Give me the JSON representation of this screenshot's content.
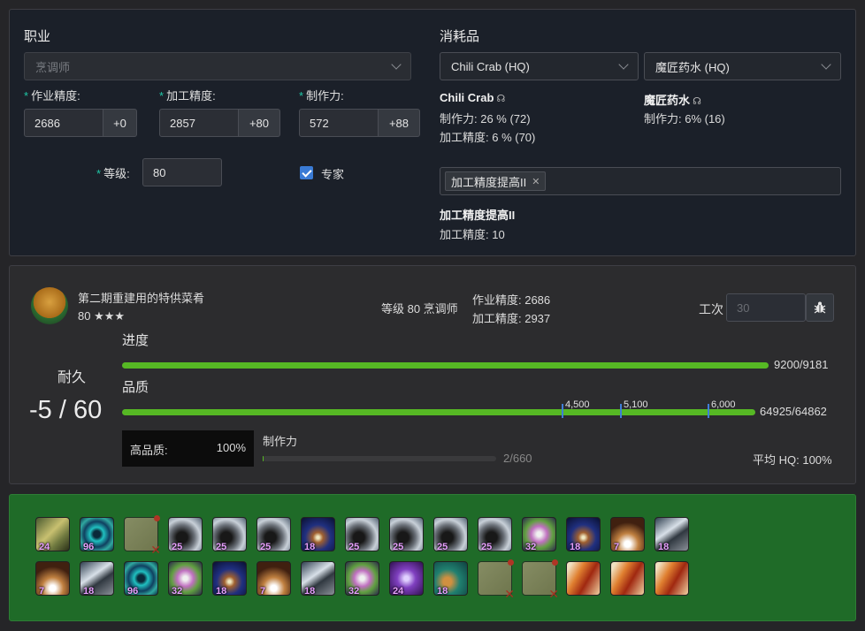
{
  "job": {
    "title": "职业",
    "class_placeholder": "烹调师",
    "craftsmanship_label": "作业精度:",
    "craftsmanship": "2686",
    "craftsmanship_bonus": "+0",
    "control_label": "加工精度:",
    "control": "2857",
    "control_bonus": "+80",
    "cp_label": "制作力:",
    "cp": "572",
    "cp_bonus": "+88",
    "level_label": "等级:",
    "level": "80",
    "specialist_label": "专家"
  },
  "consumables": {
    "title": "消耗品",
    "food_select": "Chili Crab (HQ)",
    "potion_select": "魔匠药水 (HQ)",
    "food": {
      "name": "Chili Crab",
      "line1": "制作力: 26 % (72)",
      "line2": "加工精度: 6 % (70)"
    },
    "potion": {
      "name": "魔匠药水",
      "line1": "制作力: 6% (16)"
    },
    "buff_tag": "加工精度提高II",
    "buff_name": "加工精度提高II",
    "buff_line": "加工精度: 10"
  },
  "sim": {
    "recipe_name": "第二期重建用的特供菜肴",
    "recipe_level": "80 ★★★",
    "crafter_level": "等级 80 烹调师",
    "crafter_craftsmanship": "作业精度: 2686",
    "crafter_control": "加工精度: 2937",
    "steps_label": "工次",
    "steps_placeholder": "30",
    "durability_label": "耐久",
    "durability_value": "-5 / 60",
    "progress_label": "进度",
    "progress_text": "9200/9181",
    "progress_fraction": 1.0,
    "quality_label": "品质",
    "quality_text": "64925/64862",
    "quality_fraction": 1.0,
    "quality_ticks": [
      {
        "label": "4,500"
      },
      {
        "label": "5,100"
      },
      {
        "label": "6,000"
      }
    ],
    "hq_label": "高品质:",
    "hq_value": "100%",
    "cp_label": "制作力",
    "cp_text": "2/660",
    "cp_fraction": 0.003,
    "avg_hq": "平均 HQ: 100%"
  },
  "rotation": {
    "row1": [
      {
        "icon": "muscle-memory-icon",
        "num": "24"
      },
      {
        "icon": "manipulation-icon",
        "num": "96"
      },
      {
        "icon": "failed-action-icon",
        "num": "",
        "failed": true
      },
      {
        "icon": "groundwork-icon",
        "num": "25"
      },
      {
        "icon": "groundwork-icon",
        "num": "25"
      },
      {
        "icon": "groundwork-icon",
        "num": "25"
      },
      {
        "icon": "innovation-icon",
        "num": "18"
      },
      {
        "icon": "groundwork-icon",
        "num": "25"
      },
      {
        "icon": "groundwork-icon",
        "num": "25"
      },
      {
        "icon": "groundwork-icon",
        "num": "25"
      },
      {
        "icon": "groundwork-icon",
        "num": "25"
      },
      {
        "icon": "great-strides-icon",
        "num": "32"
      },
      {
        "icon": "innovation-icon",
        "num": "18"
      },
      {
        "icon": "observe-icon",
        "num": "7"
      },
      {
        "icon": "basic-touch-icon",
        "num": "18"
      }
    ],
    "row2": [
      {
        "icon": "observe-icon",
        "num": "7"
      },
      {
        "icon": "basic-touch-icon",
        "num": "18"
      },
      {
        "icon": "manipulation-icon",
        "num": "96"
      },
      {
        "icon": "great-strides-icon",
        "num": "32"
      },
      {
        "icon": "innovation-icon",
        "num": "18"
      },
      {
        "icon": "observe-icon",
        "num": "7"
      },
      {
        "icon": "basic-touch-icon",
        "num": "18"
      },
      {
        "icon": "great-strides-icon",
        "num": "32"
      },
      {
        "icon": "byregots-blessing-icon",
        "num": "24"
      },
      {
        "icon": "veneration-icon",
        "num": "18"
      },
      {
        "icon": "failed-action-icon",
        "num": "",
        "failed": true
      },
      {
        "icon": "failed-action-icon",
        "num": "",
        "failed": true
      },
      {
        "icon": "careful-synthesis-icon",
        "num": ""
      },
      {
        "icon": "careful-synthesis-icon",
        "num": ""
      },
      {
        "icon": "careful-synthesis-icon",
        "num": ""
      }
    ]
  }
}
